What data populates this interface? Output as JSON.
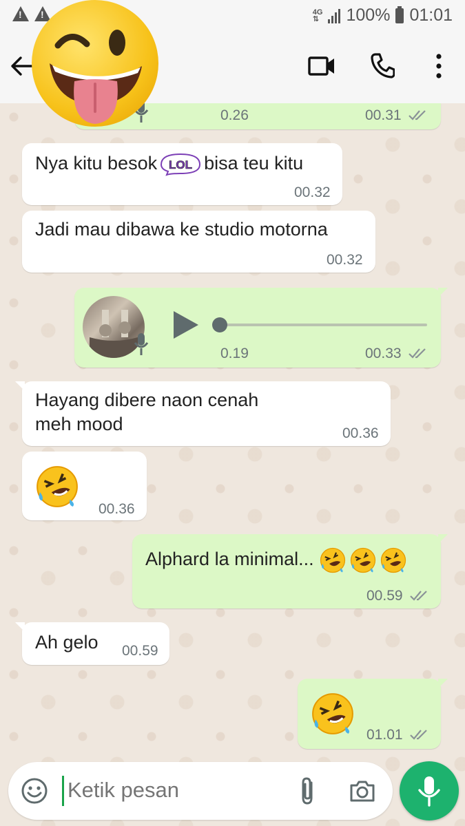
{
  "status_bar": {
    "network": "4G",
    "battery": "100%",
    "time": "01:01"
  },
  "header": {
    "avatar": "winking-tongue-emoji"
  },
  "messages": [
    {
      "id": "voice1",
      "direction": "out",
      "duration": "0.26",
      "time": "00.31",
      "ticks": "read"
    },
    {
      "id": "m1",
      "direction": "in",
      "text_before": "Nya kitu besok",
      "sticker": "LOL",
      "text_after": "bisa teu kitu",
      "time": "00.32"
    },
    {
      "id": "m2",
      "direction": "in",
      "text": "Jadi mau dibawa ke studio motorna",
      "time": "00.32"
    },
    {
      "id": "voice2",
      "direction": "out",
      "duration": "0.19",
      "time": "00.33",
      "ticks": "read",
      "progress": 0
    },
    {
      "id": "m3",
      "direction": "in",
      "line1": "Hayang dibere naon cenah",
      "line2": "meh mood",
      "time": "00.36"
    },
    {
      "id": "m4",
      "direction": "in",
      "emoji": "rolling-laughing",
      "time": "00.36"
    },
    {
      "id": "m5",
      "direction": "out",
      "text": "Alphard la minimal...",
      "emoji_count": 3,
      "time": "00.59",
      "ticks": "read"
    },
    {
      "id": "m6",
      "direction": "in",
      "text": "Ah gelo",
      "time": "00.59"
    },
    {
      "id": "m7",
      "direction": "out",
      "emoji": "rolling-laughing",
      "time": "01.01",
      "ticks": "read"
    }
  ],
  "input": {
    "placeholder": "Ketik pesan"
  },
  "colors": {
    "outgoing_bubble": "#dcf8c6",
    "incoming_bubble": "#ffffff",
    "mic_button": "#1db26e",
    "read_ticks": "#8a9297"
  }
}
